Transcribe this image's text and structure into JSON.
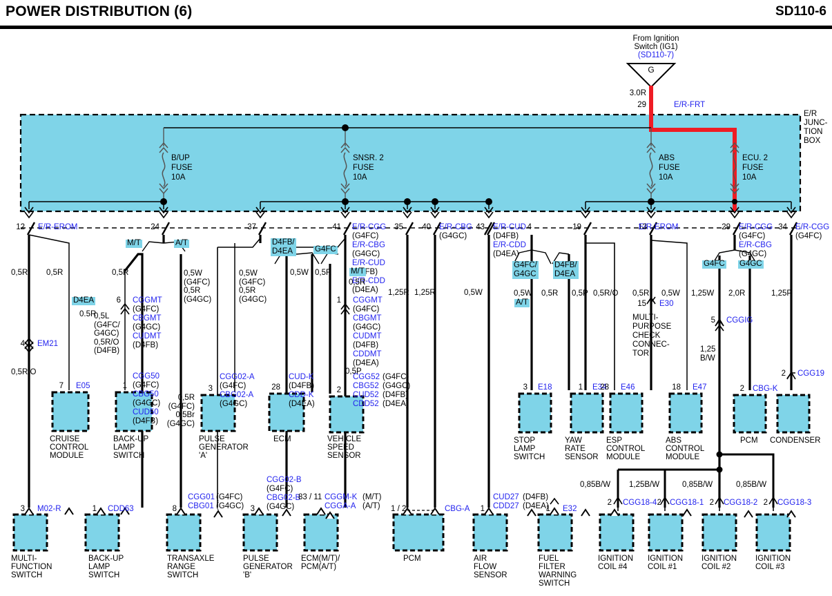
{
  "header": {
    "title": "POWER DISTRIBUTION (6)",
    "page": "SD110-6"
  },
  "source": {
    "line1": "From Ignition",
    "line2": "Switch (IG1)",
    "ref": "(SD110-7)",
    "symbol": "G",
    "wire_size": "3.0R",
    "pin": "29",
    "connector": "E/R-FRT"
  },
  "junction_box": {
    "label_lines": [
      "E/R",
      "JUNC-",
      "TION",
      "BOX"
    ]
  },
  "fuses": [
    {
      "name": "B/UP",
      "word": "FUSE",
      "rating": "10A"
    },
    {
      "name": "SNSR. 2",
      "word": "FUSE",
      "rating": "10A"
    },
    {
      "name": "ABS",
      "word": "FUSE",
      "rating": "10A"
    },
    {
      "name": "ECU. 2",
      "word": "FUSE",
      "rating": "10A"
    }
  ],
  "terminals": [
    {
      "pin": "12",
      "conn": "E/R-EROM"
    },
    {
      "pin": "24",
      "conn": ""
    },
    {
      "pin": "37",
      "conn": ""
    },
    {
      "pin": "41",
      "conn": "E/R-CGG"
    },
    {
      "pin": "35",
      "conn": ""
    },
    {
      "pin": "40",
      "conn": "E/R-CBG"
    },
    {
      "pin": "43",
      "conn": "E/R-CUD"
    },
    {
      "pin": "4",
      "conn": ""
    },
    {
      "pin": "19",
      "conn": ""
    },
    {
      "pin": "13",
      "conn": "E/R-EROM"
    },
    {
      "pin": "29",
      "conn": "E/R-CGG"
    },
    {
      "pin": "34",
      "conn": "E/R-CGG"
    }
  ],
  "conn_groups": {
    "t41": [
      {
        "code": "E/R-CGG",
        "var": "(G4FC)"
      },
      {
        "code": "E/R-CBG",
        "var": "(G4GC)"
      },
      {
        "code": "E/R-CUD",
        "var": "(D4FB)"
      },
      {
        "code": "E/R-CDD",
        "var": "(D4EA)"
      }
    ],
    "t40": [
      {
        "code": "E/R-CBG",
        "var": "(G4GC)"
      }
    ],
    "t43": [
      {
        "code": "E/R-CUD",
        "var": "(D4FB)"
      },
      {
        "code": "E/R-CDD",
        "var": "(D4EA)"
      }
    ],
    "t29": [
      {
        "code": "E/R-CGG",
        "var": "(G4FC)"
      },
      {
        "code": "E/R-CBG",
        "var": "(G4GC)"
      }
    ],
    "t34": [
      {
        "code": "E/R-CGG",
        "var": "(G4FC)"
      }
    ]
  },
  "variant_tags": [
    {
      "label": "M/T"
    },
    {
      "label": "A/T"
    },
    {
      "label": "D4EA"
    },
    {
      "label": "D4FB/\nD4EA"
    },
    {
      "label": "G4FC"
    },
    {
      "label": "M/T"
    },
    {
      "label": "A/T"
    },
    {
      "label": "G4FC/\nG4GC"
    },
    {
      "label": "D4FB/\nD4EA"
    },
    {
      "label": "G4FC"
    },
    {
      "label": "G4GC"
    }
  ],
  "wire_sizes": [
    "0,5R",
    "0,5R",
    "0,5R",
    "0,5W\n(G4FC)\n0,5R\n(G4GC)",
    "0,5W\n(G4FC)\n0,5R\n(G4GC)",
    "0,5W",
    "0,5R",
    "0,5R",
    "1,25R",
    "1,25R",
    "0,5W",
    "0,5W",
    "0,5R",
    "0,5P",
    "0,5R/O",
    "0,5R",
    "0,5W",
    "1,25W",
    "2,0R",
    "1,25P",
    "0,5R",
    "0,5R/O",
    "0.5R",
    "0,5P",
    "1,25\nB/W",
    "0,85B/W",
    "1,25B/W",
    "0,85B/W",
    "0,85B/W",
    "0,5L\n(G4FC/\nG4GC)\n0,5R/O\n(D4FB)",
    "0,5R\n(G4FC)\n0,5Br\n(G4GC)"
  ],
  "splices": [
    {
      "pin": "4",
      "code": "EM21"
    },
    {
      "pin": "6",
      "codes": [
        {
          "code": "CGGMT",
          "var": "(G4FC)"
        },
        {
          "code": "CBGMT",
          "var": "(G4GC)"
        },
        {
          "code": "CUDMT",
          "var": "(D4FB)"
        }
      ]
    },
    {
      "pin": "1",
      "codes": [
        {
          "code": "CGGMT",
          "var": "(G4FC)"
        },
        {
          "code": "CBGMT",
          "var": "(G4GC)"
        },
        {
          "code": "CUDMT",
          "var": "(D4FB)"
        },
        {
          "code": "CDDMT",
          "var": "(D4EA)"
        }
      ]
    },
    {
      "pin": "15",
      "code": "E30"
    },
    {
      "pin": "5",
      "code": "CGGIG"
    },
    {
      "pin": "2",
      "code": "CGG19"
    },
    {
      "pin": "1",
      "code": "E32"
    }
  ],
  "inline_codes": {
    "backup_lamp_switch_mid": [
      {
        "code": "CGG50",
        "var": "(G4FC)"
      },
      {
        "code": "CBG50",
        "var": "(G4GC)"
      },
      {
        "code": "CUD50",
        "var": "(D4FB)"
      }
    ],
    "pulse_gen_a": [
      {
        "code": "CGG02-A",
        "var": "(G4FC)"
      },
      {
        "code": "CBG02-A",
        "var": "(G4GC)"
      }
    ],
    "ecm_mid": [
      {
        "code": "CUD-K",
        "var": "(D4FB)"
      },
      {
        "code": "CDD-K",
        "var": "(D4EA)"
      }
    ],
    "vss": [
      {
        "code": "CGG52",
        "var": "(G4FC)"
      },
      {
        "code": "CBG52",
        "var": "(G4GC)"
      },
      {
        "code": "CUD52",
        "var": "(D4FB)"
      },
      {
        "code": "CDD52",
        "var": "(D4EA)"
      }
    ],
    "transaxle": [
      {
        "code": "CGG01",
        "var": "(G4FC)"
      },
      {
        "code": "CBG01",
        "var": "(G4GC)"
      }
    ],
    "pulse_gen_b": [
      {
        "code": "CGG02-B",
        "var": "(G4FC)"
      },
      {
        "code": "CBG02-B",
        "var": "(G4GC)"
      }
    ],
    "ecm_pcm": [
      {
        "code": "CGGM-K",
        "var": "(M/T)"
      },
      {
        "code": "CGGA-A",
        "var": "(A/T)"
      }
    ],
    "air_flow": [
      {
        "code": "CUD27",
        "var": "(D4FB)"
      },
      {
        "code": "CDD27",
        "var": "(D4EA)"
      }
    ]
  },
  "multipurpose": {
    "lines": [
      "MULTI-",
      "PURPOSE",
      "CHECK",
      "CONNEC-",
      "TOR"
    ]
  },
  "components_mid": [
    {
      "pin": "7",
      "code": "E05",
      "name": "CRUISE\nCONTROL\nMODULE"
    },
    {
      "pin": "1",
      "code": "",
      "name": "BACK-UP\nLAMP\nSWITCH"
    },
    {
      "pin": "3",
      "code": "",
      "name": "PULSE\nGENERATOR\n'A'"
    },
    {
      "pin": "28",
      "code": "",
      "name": "ECM"
    },
    {
      "pin": "2",
      "code": "",
      "name": "VEHICLE\nSPEED\nSENSOR"
    },
    {
      "pin": "3",
      "code": "E18",
      "name": "STOP\nLAMP\nSWITCH"
    },
    {
      "pin": "1",
      "code": "E34",
      "name": "YAW\nRATE\nSENSOR"
    },
    {
      "pin": "28",
      "code": "E46",
      "name": "ESP\nCONTROL\nMODULE"
    },
    {
      "pin": "18",
      "code": "E47",
      "name": "ABS\nCONTROL\nMODULE"
    },
    {
      "pin": "2",
      "code": "CBG-K",
      "name": "PCM"
    },
    {
      "pin": "2",
      "code": "CGG19",
      "name": "CONDENSER"
    }
  ],
  "components_bottom": [
    {
      "pin": "3",
      "code": "M02-R",
      "name": "MULTI-\nFUNCTION\nSWITCH"
    },
    {
      "pin": "1",
      "code": "CDD63",
      "name": "BACK-UP\nLAMP\nSWITCH"
    },
    {
      "pin": "8",
      "code": "",
      "name": "TRANSAXLE\nRANGE\nSWITCH"
    },
    {
      "pin": "3",
      "code": "",
      "name": "PULSE\nGENERATOR\n'B'"
    },
    {
      "pin": "83 / 11",
      "code": "",
      "name": "ECM(M/T)/\nPCM(A/T)"
    },
    {
      "pin": "1 / 2",
      "code": "CBG-A",
      "name": "PCM"
    },
    {
      "pin": "1",
      "code": "",
      "name": "AIR\nFLOW\nSENSOR"
    },
    {
      "pin": "1",
      "code": "E32",
      "name": "FUEL\nFILTER\nWARNING\nSWITCH"
    },
    {
      "pin": "2",
      "code": "CGG18-4",
      "name": "IGNITION\nCOIL #4"
    },
    {
      "pin": "2",
      "code": "CGG18-1",
      "name": "IGNITION\nCOIL #1"
    },
    {
      "pin": "2",
      "code": "CGG18-2",
      "name": "IGNITION\nCOIL #2"
    },
    {
      "pin": "2",
      "code": "CGG18-3",
      "name": "IGNITION\nCOIL #3"
    }
  ],
  "colors": {
    "box_fill": "#7fd4e8",
    "power_wire": "#ee1c24",
    "code_text": "#2222ee",
    "line": "#000000"
  }
}
